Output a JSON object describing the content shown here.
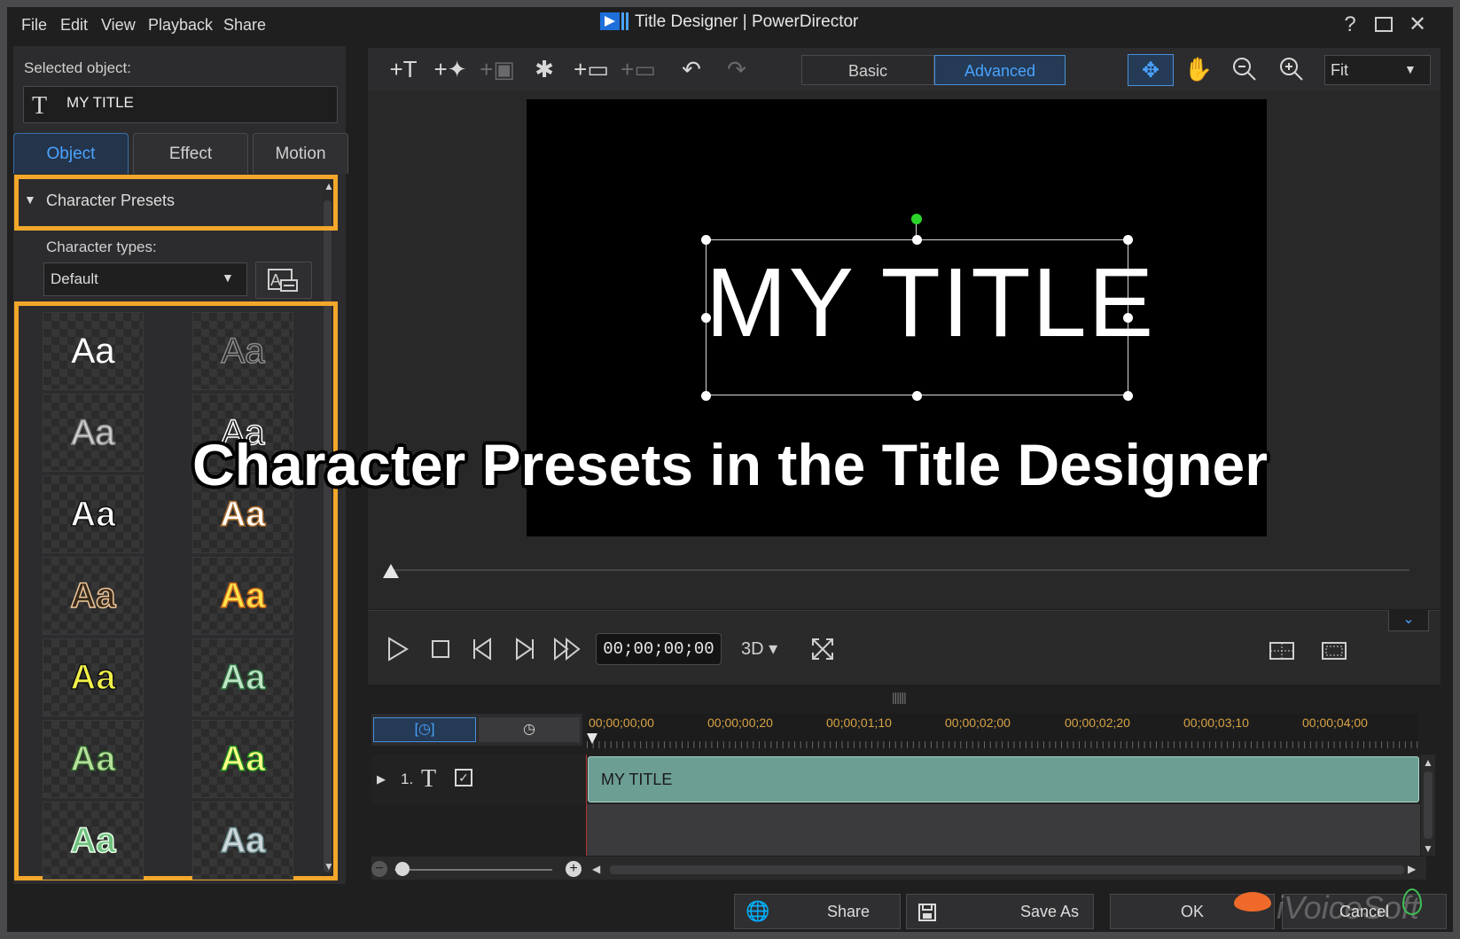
{
  "window": {
    "title": "Title Designer  |  PowerDirector",
    "icons": [
      "app-logo-icon",
      "help-icon",
      "maximize-icon",
      "close-icon"
    ]
  },
  "menu": [
    "File",
    "Edit",
    "View",
    "Playback",
    "Share"
  ],
  "selected_object": {
    "label": "Selected object:",
    "icon": "text-t-icon",
    "value": "MY TITLE"
  },
  "tabs": [
    "Object",
    "Effect",
    "Motion"
  ],
  "character_presets": {
    "header": "Character Presets",
    "types_label": "Character types:",
    "types_value": "Default",
    "swatch_text": "Aa",
    "swatches": [
      {
        "fill": "#ffffff",
        "stroke": "none"
      },
      {
        "fill": "#2a2a2a",
        "stroke": "#8a8a8a"
      },
      {
        "fill": "#d8d8d8",
        "stroke": "#8a8a8a"
      },
      {
        "fill": "#1a1a1a",
        "stroke": "#ffffff"
      },
      {
        "fill": "#ffffff",
        "stroke": "#111111"
      },
      {
        "fill": "#ffffff",
        "stroke": "#a86a2a"
      },
      {
        "fill": "#3a2a1a",
        "stroke": "#f0c89a"
      },
      {
        "fill": "#ffe24a",
        "stroke": "#c8641a"
      },
      {
        "fill": "#f2f24a",
        "stroke": "#111111"
      },
      {
        "fill": "#bfe6c8",
        "stroke": "#2e6e3e"
      },
      {
        "fill": "#b6e09a",
        "stroke": "#2a5a2a"
      },
      {
        "fill": "#ffff88",
        "stroke": "#1e8c1e"
      },
      {
        "fill": "#6fbf7f",
        "stroke": "#e8ffe8"
      },
      {
        "fill": "#cfd8dc",
        "stroke": "#6a8a8a"
      }
    ]
  },
  "toolbar": {
    "mode_basic": "Basic",
    "mode_advanced": "Advanced",
    "zoom": "Fit"
  },
  "canvas": {
    "title_text": "MY TITLE"
  },
  "transport": {
    "timecode": "00;00;00;00",
    "mode_3d": "3D"
  },
  "timeline": {
    "btn1": "[◷]",
    "btn2": "◷",
    "ticks": [
      "00;00;00;00",
      "00;00;00;20",
      "00;00;01;10",
      "00;00;02;00",
      "00;00;02;20",
      "00;00;03;10",
      "00;00;04;00"
    ],
    "track_number": "1.",
    "clip_label": "MY TITLE"
  },
  "buttons": {
    "share": "Share",
    "save_as": "Save As",
    "ok": "OK",
    "cancel": "Cancel"
  },
  "overlay_caption": "Character Presets in the Title Designer",
  "watermark": "iVoiceSoft",
  "colors": {
    "highlight": "#f2a72b",
    "accent": "#4aa3ff",
    "clip": "#6c9e94"
  }
}
